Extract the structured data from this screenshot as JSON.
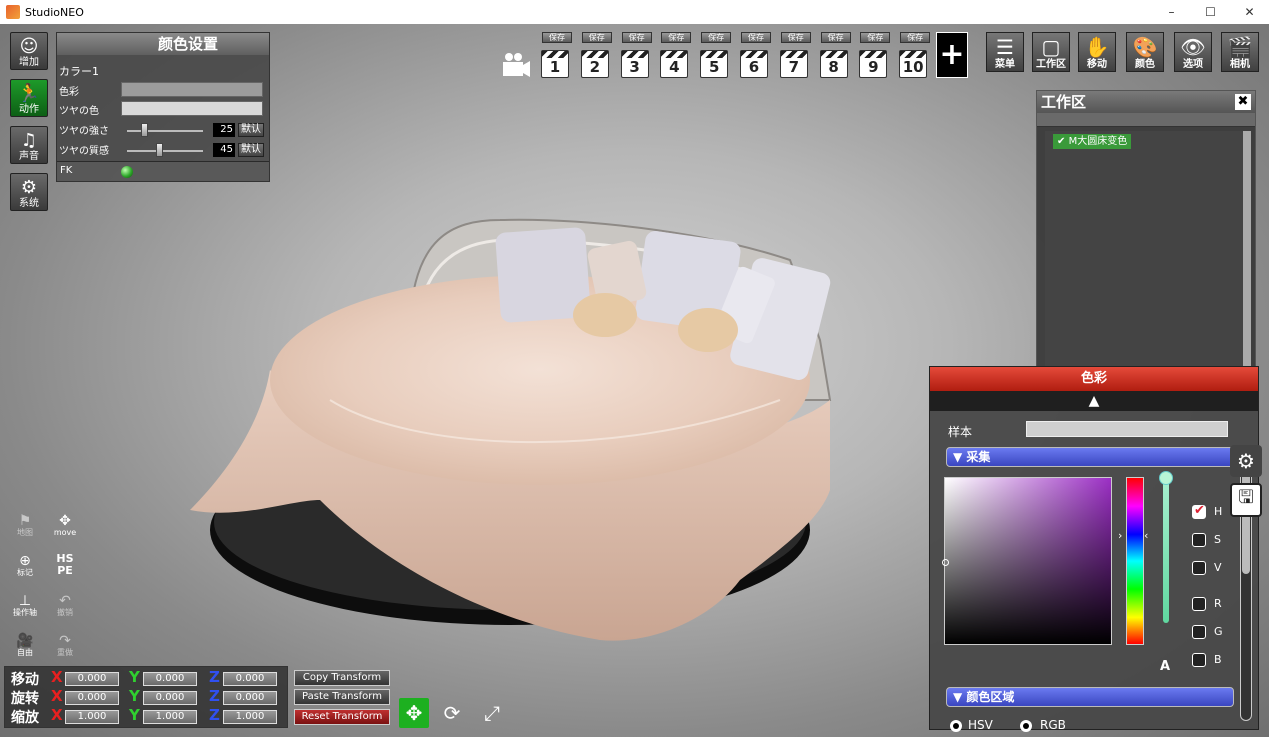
{
  "window": {
    "title": "StudioNEO",
    "minimize": "–",
    "maximize": "☐",
    "close": "✕"
  },
  "left_menu": [
    {
      "label": "增加",
      "icon": "person-icon"
    },
    {
      "label": "动作",
      "icon": "running-man-icon"
    },
    {
      "label": "声音",
      "icon": "music-note-icon"
    },
    {
      "label": "系统",
      "icon": "gears-icon"
    }
  ],
  "color_settings": {
    "title": "颜色设置",
    "section": "カラー1",
    "color_label": "色彩",
    "gloss_color_label": "ツヤの色",
    "gloss_strength_label": "ツヤの強さ",
    "gloss_strength_value": "25",
    "gloss_texture_label": "ツヤの質感",
    "gloss_texture_value": "45",
    "default_label": "默认",
    "fk_label": "FK",
    "color_swatch": "#9c9c9c",
    "gloss_color_swatch": "#d9d9d9"
  },
  "toolbar": {
    "save_label": "保存",
    "camera_slots": [
      "1",
      "2",
      "3",
      "4",
      "5",
      "6",
      "7",
      "8",
      "9",
      "10"
    ],
    "add_label": "+",
    "buttons": [
      {
        "label": "菜单",
        "icon": "list-icon"
      },
      {
        "label": "工作区",
        "icon": "window-icon"
      },
      {
        "label": "移动",
        "icon": "hand-icon"
      },
      {
        "label": "颜色",
        "icon": "palette-icon"
      },
      {
        "label": "选项",
        "icon": "eye-icon"
      },
      {
        "label": "相机",
        "icon": "clapper-icon"
      }
    ]
  },
  "workspace": {
    "title": "工作区",
    "close": "✖",
    "items": [
      "M大圆床变色"
    ]
  },
  "picker": {
    "title": "色彩",
    "sample_label": "样本",
    "collect_label": "采集",
    "color_area_label": "颜色区域",
    "alpha_label": "A",
    "channels": [
      {
        "label": "H",
        "checked": true
      },
      {
        "label": "S",
        "checked": false
      },
      {
        "label": "V",
        "checked": false
      },
      {
        "label": "R",
        "checked": false
      },
      {
        "label": "G",
        "checked": false
      },
      {
        "label": "B",
        "checked": false
      }
    ],
    "modes": [
      {
        "label": "HSV",
        "selected": true
      },
      {
        "label": "RGB",
        "selected": false
      }
    ]
  },
  "left_tools": [
    {
      "label": "地图",
      "icon": "map-icon",
      "enabled": false
    },
    {
      "label": "move",
      "icon": "move-icon",
      "enabled": true
    },
    {
      "label": "标记",
      "icon": "plus-circle-icon",
      "enabled": true
    },
    {
      "label": "HS\nPE",
      "icon": "hspe-icon",
      "enabled": true
    },
    {
      "label": "操作轴",
      "icon": "axis-icon",
      "enabled": true
    },
    {
      "label": "撤销",
      "icon": "undo-icon",
      "enabled": false
    },
    {
      "label": "自由",
      "icon": "camera-icon",
      "enabled": true
    },
    {
      "label": "重做",
      "icon": "redo-icon",
      "enabled": false
    }
  ],
  "transform": {
    "move_label": "移动",
    "rotate_label": "旋转",
    "scale_label": "缩放",
    "x": "X",
    "y": "Y",
    "z": "Z",
    "move": [
      "0.000",
      "0.000",
      "0.000"
    ],
    "rotate": [
      "0.000",
      "0.000",
      "0.000"
    ],
    "scale": [
      "1.000",
      "1.000",
      "1.000"
    ],
    "copy_label": "Copy Transform",
    "paste_label": "Paste Transform",
    "reset_label": "Reset Transform"
  }
}
